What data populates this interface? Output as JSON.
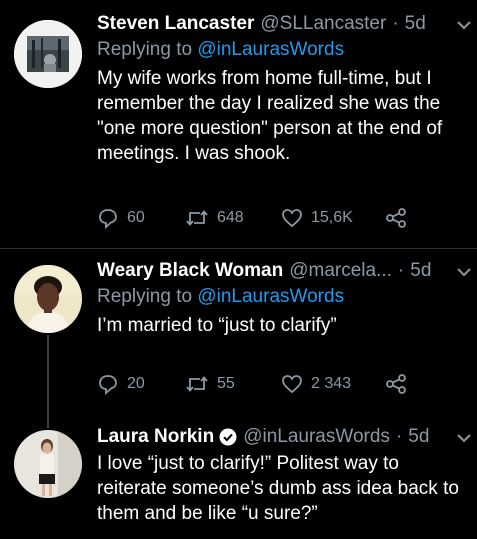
{
  "tweets": [
    {
      "name": "Steven Lancaster",
      "handle": "@SLLancaster",
      "separator": "·",
      "time": "5d",
      "replying_prefix": "Replying to",
      "replying_to": "@inLaurasWords",
      "text": "My wife works from home full-time, but I remember the day I realized she was the \"one more question\" person at the end of meetings. I was shook.",
      "replies": "60",
      "retweets": "648",
      "likes": "15,6K"
    },
    {
      "name": "Weary Black Woman",
      "handle": "@marcela...",
      "separator": "·",
      "time": "5d",
      "replying_prefix": "Replying to",
      "replying_to": "@inLaurasWords",
      "text": "I’m married to “just to clarify”",
      "replies": "20",
      "retweets": "55",
      "likes": "2 343"
    },
    {
      "name": "Laura Norkin",
      "handle": "@inLaurasWords",
      "separator": "·",
      "time": "5d",
      "verified": true,
      "text": "I love “just to clarify!” Politest way to reiterate someone’s dumb ass idea back to them and be like “u sure?”"
    }
  ],
  "colors": {
    "background": "#000000",
    "text": "#ffffff",
    "muted": "#8b98a5",
    "link": "#1d9bf0",
    "divider": "#2f3336"
  },
  "icons": [
    "chevron-down-icon",
    "reply-icon",
    "retweet-icon",
    "like-icon",
    "share-icon",
    "verified-badge-icon"
  ]
}
